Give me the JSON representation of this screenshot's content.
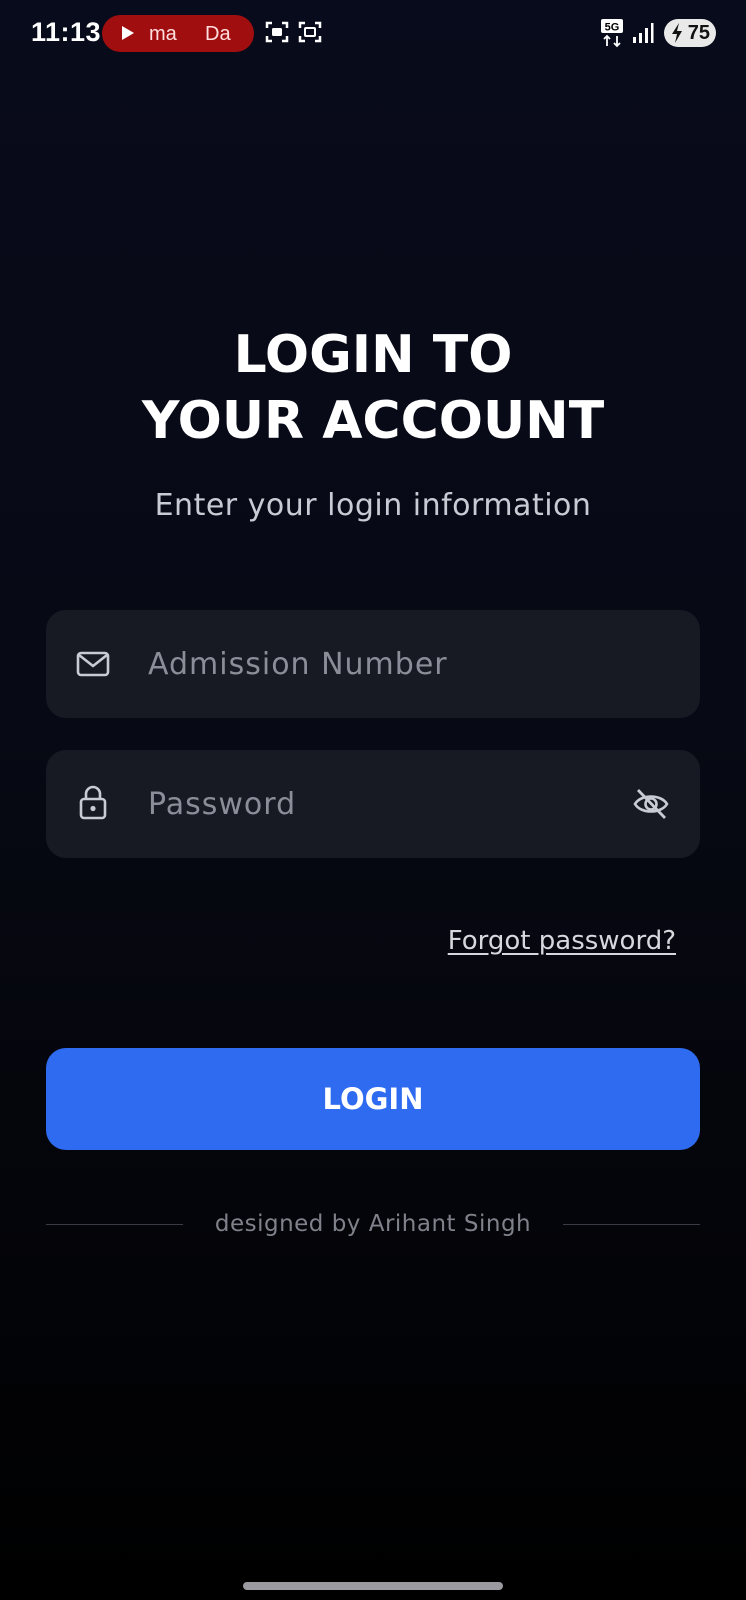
{
  "status_bar": {
    "time": "11:13",
    "media_pill_text_1": "ma",
    "media_pill_text_2": "Da",
    "network": "5G",
    "battery_level": "75",
    "icons": [
      "play-icon",
      "screen-record-icon",
      "screenshot-icon",
      "5g-icon",
      "signal-icon",
      "battery-charging-icon"
    ]
  },
  "login": {
    "title_line_1": "LOGIN TO",
    "title_line_2": "YOUR ACCOUNT",
    "subtitle": "Enter your login information",
    "admission_field": {
      "placeholder": "Admission Number",
      "value": "",
      "icon": "mail-icon"
    },
    "password_field": {
      "placeholder": "Password",
      "value": "",
      "icon": "lock-icon",
      "toggle_icon": "eye-off-icon"
    },
    "forgot_password": "Forgot password?",
    "login_button": "LOGIN",
    "footer_credit": "designed by Arihant Singh"
  },
  "colors": {
    "background_top": "#080b1b",
    "background_bottom": "#000000",
    "field_background": "#181a23",
    "accent": "#2f6bf1",
    "media_pill": "#a10e10"
  }
}
